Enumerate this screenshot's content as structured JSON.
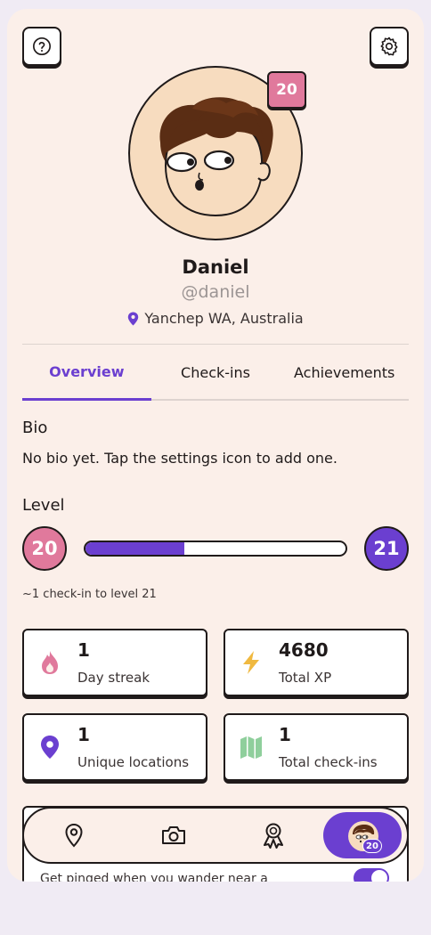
{
  "colors": {
    "accent": "#6b3fd0",
    "pink": "#e0799c",
    "background": "#fbefe9"
  },
  "header": {
    "help_icon": "question-circle-icon",
    "settings_icon": "gear-icon",
    "level_badge": "20"
  },
  "profile": {
    "name": "Daniel",
    "handle": "@daniel",
    "location": "Yanchep WA, Australia"
  },
  "tabs": [
    {
      "label": "Overview",
      "active": true
    },
    {
      "label": "Check-ins",
      "active": false
    },
    {
      "label": "Achievements",
      "active": false
    }
  ],
  "bio": {
    "title": "Bio",
    "text": "No bio yet. Tap the settings icon to add one."
  },
  "level": {
    "title": "Level",
    "current": "20",
    "next": "21",
    "progress_fraction": 0.38,
    "hint": "~1 check-in to level 21"
  },
  "stats": [
    {
      "value": "1",
      "label": "Day streak",
      "icon": "flame-icon",
      "color": "#e0799c"
    },
    {
      "value": "4680",
      "label": "Total XP",
      "icon": "lightning-icon",
      "color": "#f0b940"
    },
    {
      "value": "1",
      "label": "Unique locations",
      "icon": "location-pin-icon",
      "color": "#6b3fd0"
    },
    {
      "value": "1",
      "label": "Total check-ins",
      "icon": "map-icon",
      "color": "#8fcf9c"
    }
  ],
  "notification": {
    "text": "Get pinged when you wander near a",
    "toggle_on": true
  },
  "bottom_nav": {
    "items": [
      "map-pin-icon",
      "camera-icon",
      "award-ribbon-icon",
      "profile-avatar"
    ],
    "profile_badge": "20"
  }
}
